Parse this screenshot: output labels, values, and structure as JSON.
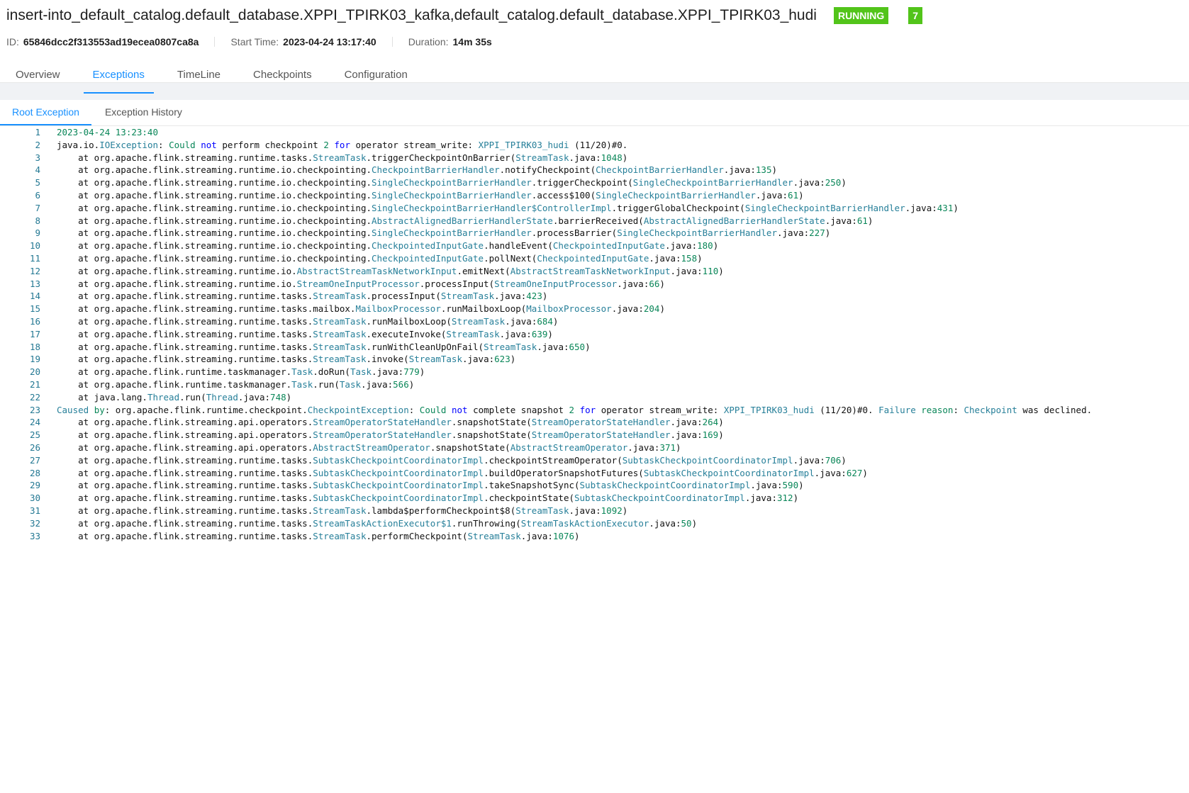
{
  "job": {
    "title": "insert-into_default_catalog.default_database.XPPI_TPIRK03_kafka,default_catalog.default_database.XPPI_TPIRK03_hudi",
    "status": "RUNNING",
    "count": "7",
    "id_label": "ID:",
    "id_value": "65846dcc2f313553ad19ecea0807ca8a",
    "start_label": "Start Time:",
    "start_value": "2023-04-24 13:17:40",
    "duration_label": "Duration:",
    "duration_value": "14m 35s"
  },
  "tabs": [
    "Overview",
    "Exceptions",
    "TimeLine",
    "Checkpoints",
    "Configuration"
  ],
  "subtabs": [
    "Root Exception",
    "Exception History"
  ],
  "colors": {
    "accent": "#1890ff",
    "running": "#52c41a"
  },
  "log_lines": [
    {
      "n": "1",
      "segs": [
        [
          "2023-04-24 13:23:40",
          "t"
        ]
      ]
    },
    {
      "n": "2",
      "segs": [
        [
          "java.io.",
          ""
        ],
        [
          "IOException",
          "cls"
        ],
        [
          ": ",
          ""
        ],
        [
          "Could",
          "t"
        ],
        [
          " ",
          ""
        ],
        [
          "not",
          "kw"
        ],
        [
          " perform checkpoint ",
          ""
        ],
        [
          "2",
          "t"
        ],
        [
          " ",
          ""
        ],
        [
          "for",
          "kw"
        ],
        [
          " operator stream_write: ",
          ""
        ],
        [
          "XPPI_TPIRK03_hudi",
          "cls"
        ],
        [
          " (11/20)#0.",
          ""
        ]
      ]
    },
    {
      "n": "3",
      "segs": [
        [
          "    at org.apache.flink.streaming.runtime.tasks.",
          ""
        ],
        [
          "StreamTask",
          "cls"
        ],
        [
          ".triggerCheckpointOnBarrier(",
          ""
        ],
        [
          "StreamTask",
          "cls"
        ],
        [
          ".java:",
          ""
        ],
        [
          "1048",
          "t"
        ],
        [
          ")",
          ""
        ]
      ]
    },
    {
      "n": "4",
      "segs": [
        [
          "    at org.apache.flink.streaming.runtime.io.checkpointing.",
          ""
        ],
        [
          "CheckpointBarrierHandler",
          "cls"
        ],
        [
          ".notifyCheckpoint(",
          ""
        ],
        [
          "CheckpointBarrierHandler",
          "cls"
        ],
        [
          ".java:",
          ""
        ],
        [
          "135",
          "t"
        ],
        [
          ")",
          ""
        ]
      ]
    },
    {
      "n": "5",
      "segs": [
        [
          "    at org.apache.flink.streaming.runtime.io.checkpointing.",
          ""
        ],
        [
          "SingleCheckpointBarrierHandler",
          "cls"
        ],
        [
          ".triggerCheckpoint(",
          ""
        ],
        [
          "SingleCheckpointBarrierHandler",
          "cls"
        ],
        [
          ".java:",
          ""
        ],
        [
          "250",
          "t"
        ],
        [
          ")",
          ""
        ]
      ]
    },
    {
      "n": "6",
      "segs": [
        [
          "    at org.apache.flink.streaming.runtime.io.checkpointing.",
          ""
        ],
        [
          "SingleCheckpointBarrierHandler",
          "cls"
        ],
        [
          ".access$100(",
          ""
        ],
        [
          "SingleCheckpointBarrierHandler",
          "cls"
        ],
        [
          ".java:",
          ""
        ],
        [
          "61",
          "t"
        ],
        [
          ")",
          ""
        ]
      ]
    },
    {
      "n": "7",
      "segs": [
        [
          "    at org.apache.flink.streaming.runtime.io.checkpointing.",
          ""
        ],
        [
          "SingleCheckpointBarrierHandler$ControllerImpl",
          "cls"
        ],
        [
          ".triggerGlobalCheckpoint(",
          ""
        ],
        [
          "SingleCheckpointBarrierHandler",
          "cls"
        ],
        [
          ".java:",
          ""
        ],
        [
          "431",
          "t"
        ],
        [
          ")",
          ""
        ]
      ]
    },
    {
      "n": "8",
      "segs": [
        [
          "    at org.apache.flink.streaming.runtime.io.checkpointing.",
          ""
        ],
        [
          "AbstractAlignedBarrierHandlerState",
          "cls"
        ],
        [
          ".barrierReceived(",
          ""
        ],
        [
          "AbstractAlignedBarrierHandlerState",
          "cls"
        ],
        [
          ".java:",
          ""
        ],
        [
          "61",
          "t"
        ],
        [
          ")",
          ""
        ]
      ]
    },
    {
      "n": "9",
      "segs": [
        [
          "    at org.apache.flink.streaming.runtime.io.checkpointing.",
          ""
        ],
        [
          "SingleCheckpointBarrierHandler",
          "cls"
        ],
        [
          ".processBarrier(",
          ""
        ],
        [
          "SingleCheckpointBarrierHandler",
          "cls"
        ],
        [
          ".java:",
          ""
        ],
        [
          "227",
          "t"
        ],
        [
          ")",
          ""
        ]
      ]
    },
    {
      "n": "10",
      "segs": [
        [
          "    at org.apache.flink.streaming.runtime.io.checkpointing.",
          ""
        ],
        [
          "CheckpointedInputGate",
          "cls"
        ],
        [
          ".handleEvent(",
          ""
        ],
        [
          "CheckpointedInputGate",
          "cls"
        ],
        [
          ".java:",
          ""
        ],
        [
          "180",
          "t"
        ],
        [
          ")",
          ""
        ]
      ]
    },
    {
      "n": "11",
      "segs": [
        [
          "    at org.apache.flink.streaming.runtime.io.checkpointing.",
          ""
        ],
        [
          "CheckpointedInputGate",
          "cls"
        ],
        [
          ".pollNext(",
          ""
        ],
        [
          "CheckpointedInputGate",
          "cls"
        ],
        [
          ".java:",
          ""
        ],
        [
          "158",
          "t"
        ],
        [
          ")",
          ""
        ]
      ]
    },
    {
      "n": "12",
      "segs": [
        [
          "    at org.apache.flink.streaming.runtime.io.",
          ""
        ],
        [
          "AbstractStreamTaskNetworkInput",
          "cls"
        ],
        [
          ".emitNext(",
          ""
        ],
        [
          "AbstractStreamTaskNetworkInput",
          "cls"
        ],
        [
          ".java:",
          ""
        ],
        [
          "110",
          "t"
        ],
        [
          ")",
          ""
        ]
      ]
    },
    {
      "n": "13",
      "segs": [
        [
          "    at org.apache.flink.streaming.runtime.io.",
          ""
        ],
        [
          "StreamOneInputProcessor",
          "cls"
        ],
        [
          ".processInput(",
          ""
        ],
        [
          "StreamOneInputProcessor",
          "cls"
        ],
        [
          ".java:",
          ""
        ],
        [
          "66",
          "t"
        ],
        [
          ")",
          ""
        ]
      ]
    },
    {
      "n": "14",
      "segs": [
        [
          "    at org.apache.flink.streaming.runtime.tasks.",
          ""
        ],
        [
          "StreamTask",
          "cls"
        ],
        [
          ".processInput(",
          ""
        ],
        [
          "StreamTask",
          "cls"
        ],
        [
          ".java:",
          ""
        ],
        [
          "423",
          "t"
        ],
        [
          ")",
          ""
        ]
      ]
    },
    {
      "n": "15",
      "segs": [
        [
          "    at org.apache.flink.streaming.runtime.tasks.mailbox.",
          ""
        ],
        [
          "MailboxProcessor",
          "cls"
        ],
        [
          ".runMailboxLoop(",
          ""
        ],
        [
          "MailboxProcessor",
          "cls"
        ],
        [
          ".java:",
          ""
        ],
        [
          "204",
          "t"
        ],
        [
          ")",
          ""
        ]
      ]
    },
    {
      "n": "16",
      "segs": [
        [
          "    at org.apache.flink.streaming.runtime.tasks.",
          ""
        ],
        [
          "StreamTask",
          "cls"
        ],
        [
          ".runMailboxLoop(",
          ""
        ],
        [
          "StreamTask",
          "cls"
        ],
        [
          ".java:",
          ""
        ],
        [
          "684",
          "t"
        ],
        [
          ")",
          ""
        ]
      ]
    },
    {
      "n": "17",
      "segs": [
        [
          "    at org.apache.flink.streaming.runtime.tasks.",
          ""
        ],
        [
          "StreamTask",
          "cls"
        ],
        [
          ".executeInvoke(",
          ""
        ],
        [
          "StreamTask",
          "cls"
        ],
        [
          ".java:",
          ""
        ],
        [
          "639",
          "t"
        ],
        [
          ")",
          ""
        ]
      ]
    },
    {
      "n": "18",
      "segs": [
        [
          "    at org.apache.flink.streaming.runtime.tasks.",
          ""
        ],
        [
          "StreamTask",
          "cls"
        ],
        [
          ".runWithCleanUpOnFail(",
          ""
        ],
        [
          "StreamTask",
          "cls"
        ],
        [
          ".java:",
          ""
        ],
        [
          "650",
          "t"
        ],
        [
          ")",
          ""
        ]
      ]
    },
    {
      "n": "19",
      "segs": [
        [
          "    at org.apache.flink.streaming.runtime.tasks.",
          ""
        ],
        [
          "StreamTask",
          "cls"
        ],
        [
          ".invoke(",
          ""
        ],
        [
          "StreamTask",
          "cls"
        ],
        [
          ".java:",
          ""
        ],
        [
          "623",
          "t"
        ],
        [
          ")",
          ""
        ]
      ]
    },
    {
      "n": "20",
      "segs": [
        [
          "    at org.apache.flink.runtime.taskmanager.",
          ""
        ],
        [
          "Task",
          "cls"
        ],
        [
          ".doRun(",
          ""
        ],
        [
          "Task",
          "cls"
        ],
        [
          ".java:",
          ""
        ],
        [
          "779",
          "t"
        ],
        [
          ")",
          ""
        ]
      ]
    },
    {
      "n": "21",
      "segs": [
        [
          "    at org.apache.flink.runtime.taskmanager.",
          ""
        ],
        [
          "Task",
          "cls"
        ],
        [
          ".run(",
          ""
        ],
        [
          "Task",
          "cls"
        ],
        [
          ".java:",
          ""
        ],
        [
          "566",
          "t"
        ],
        [
          ")",
          ""
        ]
      ]
    },
    {
      "n": "22",
      "segs": [
        [
          "    at java.lang.",
          ""
        ],
        [
          "Thread",
          "cls"
        ],
        [
          ".run(",
          ""
        ],
        [
          "Thread",
          "cls"
        ],
        [
          ".java:",
          ""
        ],
        [
          "748",
          "t"
        ],
        [
          ")",
          ""
        ]
      ]
    },
    {
      "n": "23",
      "segs": [
        [
          "Caused",
          "cls"
        ],
        [
          " ",
          ""
        ],
        [
          "by",
          "t"
        ],
        [
          ": org.apache.flink.runtime.checkpoint.",
          ""
        ],
        [
          "CheckpointException",
          "cls"
        ],
        [
          ": ",
          ""
        ],
        [
          "Could",
          "t"
        ],
        [
          " ",
          ""
        ],
        [
          "not",
          "kw"
        ],
        [
          " complete snapshot ",
          ""
        ],
        [
          "2",
          "t"
        ],
        [
          " ",
          ""
        ],
        [
          "for",
          "kw"
        ],
        [
          " operator stream_write: ",
          ""
        ],
        [
          "XPPI_TPIRK03_hudi",
          "cls"
        ],
        [
          " (11/20)#0. ",
          ""
        ],
        [
          "Failure",
          "cls"
        ],
        [
          " ",
          ""
        ],
        [
          "reason",
          "t"
        ],
        [
          ": ",
          ""
        ],
        [
          "Checkpoint",
          "cls"
        ],
        [
          " was declined.",
          ""
        ]
      ]
    },
    {
      "n": "24",
      "segs": [
        [
          "    at org.apache.flink.streaming.api.operators.",
          ""
        ],
        [
          "StreamOperatorStateHandler",
          "cls"
        ],
        [
          ".snapshotState(",
          ""
        ],
        [
          "StreamOperatorStateHandler",
          "cls"
        ],
        [
          ".java:",
          ""
        ],
        [
          "264",
          "t"
        ],
        [
          ")",
          ""
        ]
      ]
    },
    {
      "n": "25",
      "segs": [
        [
          "    at org.apache.flink.streaming.api.operators.",
          ""
        ],
        [
          "StreamOperatorStateHandler",
          "cls"
        ],
        [
          ".snapshotState(",
          ""
        ],
        [
          "StreamOperatorStateHandler",
          "cls"
        ],
        [
          ".java:",
          ""
        ],
        [
          "169",
          "t"
        ],
        [
          ")",
          ""
        ]
      ]
    },
    {
      "n": "26",
      "segs": [
        [
          "    at org.apache.flink.streaming.api.operators.",
          ""
        ],
        [
          "AbstractStreamOperator",
          "cls"
        ],
        [
          ".snapshotState(",
          ""
        ],
        [
          "AbstractStreamOperator",
          "cls"
        ],
        [
          ".java:",
          ""
        ],
        [
          "371",
          "t"
        ],
        [
          ")",
          ""
        ]
      ]
    },
    {
      "n": "27",
      "segs": [
        [
          "    at org.apache.flink.streaming.runtime.tasks.",
          ""
        ],
        [
          "SubtaskCheckpointCoordinatorImpl",
          "cls"
        ],
        [
          ".checkpointStreamOperator(",
          ""
        ],
        [
          "SubtaskCheckpointCoordinatorImpl",
          "cls"
        ],
        [
          ".java:",
          ""
        ],
        [
          "706",
          "t"
        ],
        [
          ")",
          ""
        ]
      ]
    },
    {
      "n": "28",
      "segs": [
        [
          "    at org.apache.flink.streaming.runtime.tasks.",
          ""
        ],
        [
          "SubtaskCheckpointCoordinatorImpl",
          "cls"
        ],
        [
          ".buildOperatorSnapshotFutures(",
          ""
        ],
        [
          "SubtaskCheckpointCoordinatorImpl",
          "cls"
        ],
        [
          ".java:",
          ""
        ],
        [
          "627",
          "t"
        ],
        [
          ")",
          ""
        ]
      ]
    },
    {
      "n": "29",
      "segs": [
        [
          "    at org.apache.flink.streaming.runtime.tasks.",
          ""
        ],
        [
          "SubtaskCheckpointCoordinatorImpl",
          "cls"
        ],
        [
          ".takeSnapshotSync(",
          ""
        ],
        [
          "SubtaskCheckpointCoordinatorImpl",
          "cls"
        ],
        [
          ".java:",
          ""
        ],
        [
          "590",
          "t"
        ],
        [
          ")",
          ""
        ]
      ]
    },
    {
      "n": "30",
      "segs": [
        [
          "    at org.apache.flink.streaming.runtime.tasks.",
          ""
        ],
        [
          "SubtaskCheckpointCoordinatorImpl",
          "cls"
        ],
        [
          ".checkpointState(",
          ""
        ],
        [
          "SubtaskCheckpointCoordinatorImpl",
          "cls"
        ],
        [
          ".java:",
          ""
        ],
        [
          "312",
          "t"
        ],
        [
          ")",
          ""
        ]
      ]
    },
    {
      "n": "31",
      "segs": [
        [
          "    at org.apache.flink.streaming.runtime.tasks.",
          ""
        ],
        [
          "StreamTask",
          "cls"
        ],
        [
          ".lambda$performCheckpoint$8(",
          ""
        ],
        [
          "StreamTask",
          "cls"
        ],
        [
          ".java:",
          ""
        ],
        [
          "1092",
          "t"
        ],
        [
          ")",
          ""
        ]
      ]
    },
    {
      "n": "32",
      "segs": [
        [
          "    at org.apache.flink.streaming.runtime.tasks.",
          ""
        ],
        [
          "StreamTaskActionExecutor$1",
          "cls"
        ],
        [
          ".runThrowing(",
          ""
        ],
        [
          "StreamTaskActionExecutor",
          "cls"
        ],
        [
          ".java:",
          ""
        ],
        [
          "50",
          "t"
        ],
        [
          ")",
          ""
        ]
      ]
    },
    {
      "n": "33",
      "segs": [
        [
          "    at org.apache.flink.streaming.runtime.tasks.",
          ""
        ],
        [
          "StreamTask",
          "cls"
        ],
        [
          ".performCheckpoint(",
          ""
        ],
        [
          "StreamTask",
          "cls"
        ],
        [
          ".java:",
          ""
        ],
        [
          "1076",
          "t"
        ],
        [
          ")",
          ""
        ]
      ]
    }
  ]
}
